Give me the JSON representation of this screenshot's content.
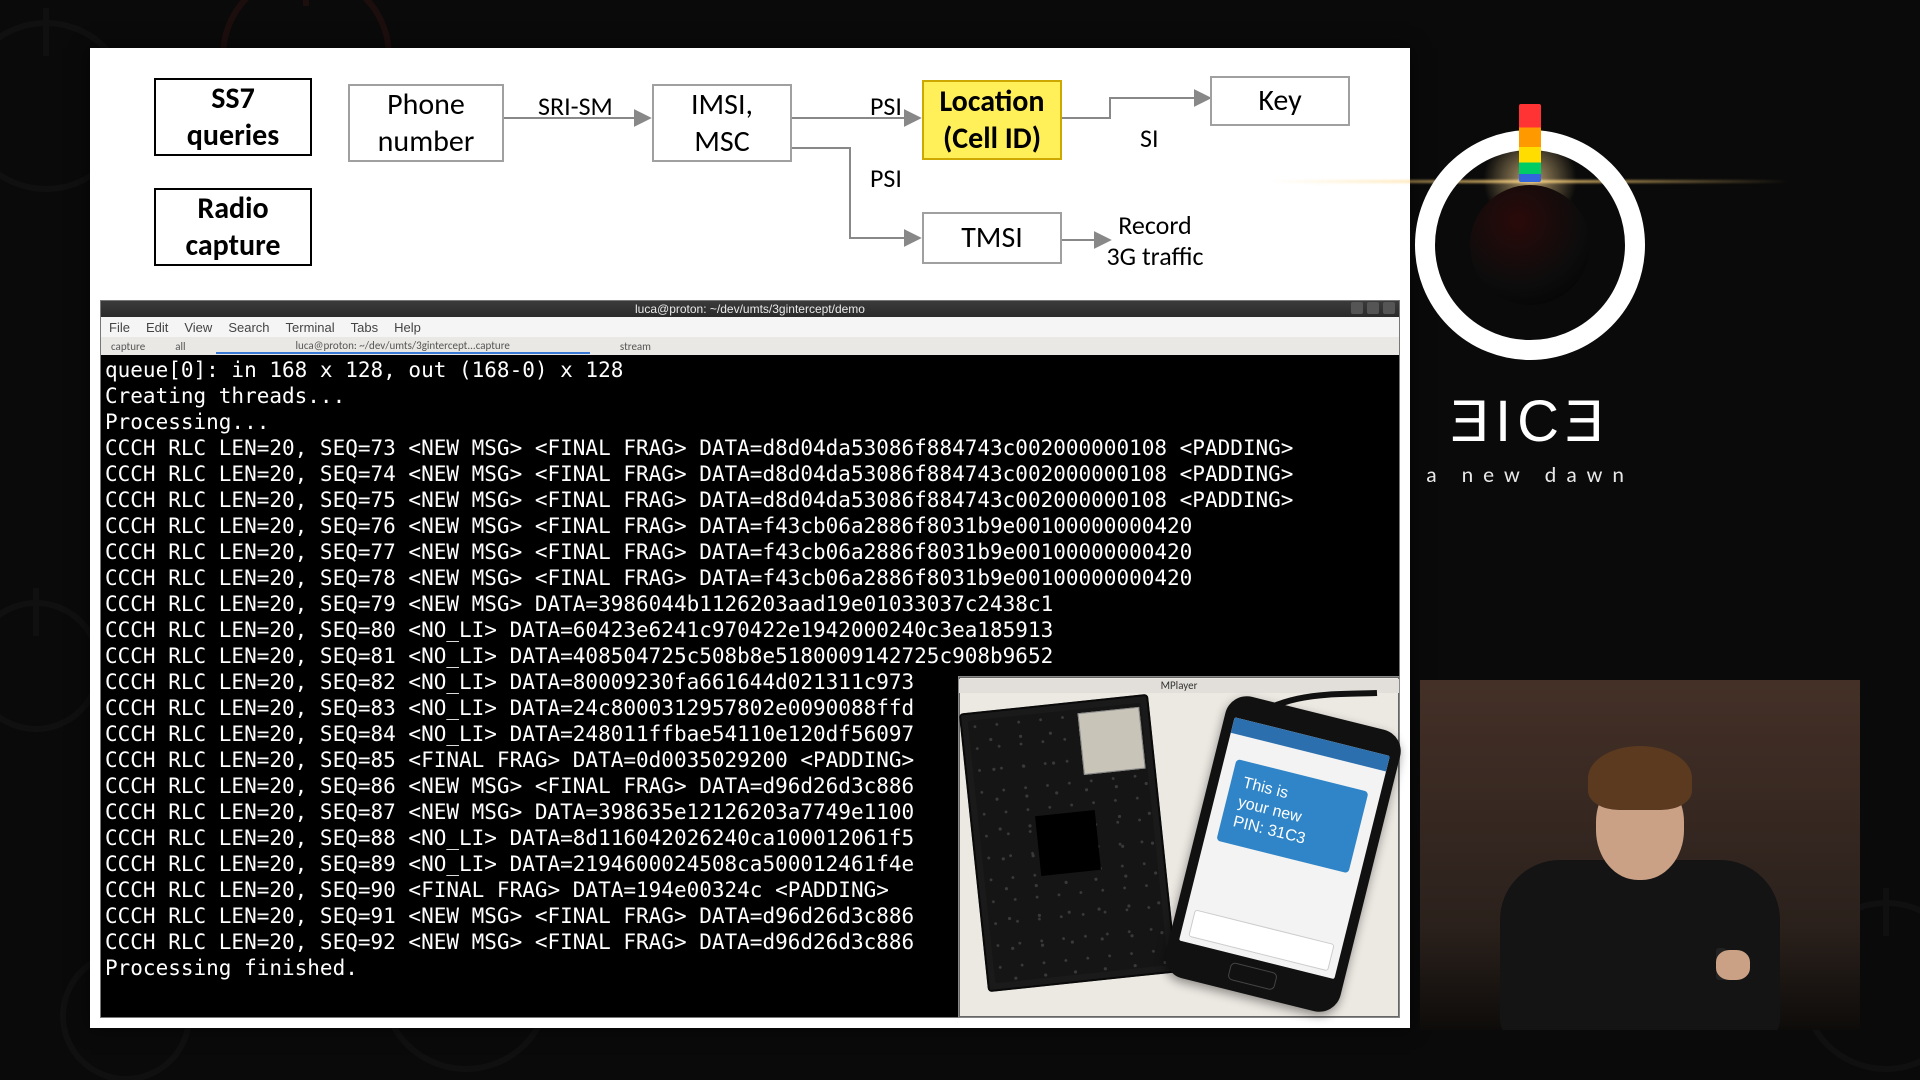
{
  "diagram": {
    "boxes": {
      "ss7": "SS7\nqueries",
      "radio": "Radio\ncapture",
      "phone": "Phone\nnumber",
      "imsi": "IMSI,\nMSC",
      "location": "Location\n(Cell ID)",
      "tmsi": "TMSI",
      "key": "Key"
    },
    "labels": {
      "sri_sm": "SRI-SM",
      "psi_top": "PSI",
      "psi_bot": "PSI",
      "si": "SI",
      "record": "Record\n3G traffic"
    }
  },
  "terminal": {
    "title": "luca@proton: ~/dev/umts/3gintercept/demo",
    "menus": [
      "File",
      "Edit",
      "View",
      "Search",
      "Terminal",
      "Tabs",
      "Help"
    ],
    "tabs": [
      "capture",
      "all",
      "luca@proton: ~/dev/umts/3gintercept...capture",
      "stream"
    ],
    "lines": [
      "queue[0]: in 168 x 128, out (168-0) x 128",
      "Creating threads...",
      "Processing...",
      "CCCH RLC LEN=20, SEQ=73 <NEW MSG> <FINAL FRAG> DATA=d8d04da53086f884743c002000000108 <PADDING>",
      "CCCH RLC LEN=20, SEQ=74 <NEW MSG> <FINAL FRAG> DATA=d8d04da53086f884743c002000000108 <PADDING>",
      "CCCH RLC LEN=20, SEQ=75 <NEW MSG> <FINAL FRAG> DATA=d8d04da53086f884743c002000000108 <PADDING>",
      "CCCH RLC LEN=20, SEQ=76 <NEW MSG> <FINAL FRAG> DATA=f43cb06a2886f8031b9e00100000000420",
      "CCCH RLC LEN=20, SEQ=77 <NEW MSG> <FINAL FRAG> DATA=f43cb06a2886f8031b9e00100000000420",
      "CCCH RLC LEN=20, SEQ=78 <NEW MSG> <FINAL FRAG> DATA=f43cb06a2886f8031b9e00100000000420",
      "CCCH RLC LEN=20, SEQ=79 <NEW MSG> DATA=3986044b1126203aad19e01033037c2438c1",
      "CCCH RLC LEN=20, SEQ=80 <NO_LI> DATA=60423e6241c970422e1942000240c3ea185913",
      "CCCH RLC LEN=20, SEQ=81 <NO_LI> DATA=408504725c508b8e5180009142725c908b9652",
      "CCCH RLC LEN=20, SEQ=82 <NO_LI> DATA=80009230fa661644d021311c973",
      "CCCH RLC LEN=20, SEQ=83 <NO_LI> DATA=24c8000312957802e0090088ffd",
      "CCCH RLC LEN=20, SEQ=84 <NO_LI> DATA=248011ffbae54110e120df56097",
      "CCCH RLC LEN=20, SEQ=85 <FINAL FRAG> DATA=0d0035029200 <PADDING>",
      "CCCH RLC LEN=20, SEQ=86 <NEW MSG> <FINAL FRAG> DATA=d96d26d3c886",
      "CCCH RLC LEN=20, SEQ=87 <NEW MSG> DATA=398635e12126203a7749e1100",
      "CCCH RLC LEN=20, SEQ=88 <NO_LI> DATA=8d116042026240ca100012061f5",
      "CCCH RLC LEN=20, SEQ=89 <NO_LI> DATA=2194600024508ca500012461f4e",
      "CCCH RLC LEN=20, SEQ=90 <FINAL FRAG> DATA=194e00324c <PADDING>",
      "CCCH RLC LEN=20, SEQ=91 <NEW MSG> <FINAL FRAG> DATA=d96d26d3c886",
      "CCCH RLC LEN=20, SEQ=92 <NEW MSG> <FINAL FRAG> DATA=d96d26d3c886",
      "Processing finished."
    ]
  },
  "photo": {
    "window_title": "MPlayer",
    "sms_line1": "This is",
    "sms_line2": "your new",
    "sms_line3": "PIN: 31C3"
  },
  "brand": {
    "wordmark": "ƎICƎ",
    "tag": "a new dawn"
  }
}
